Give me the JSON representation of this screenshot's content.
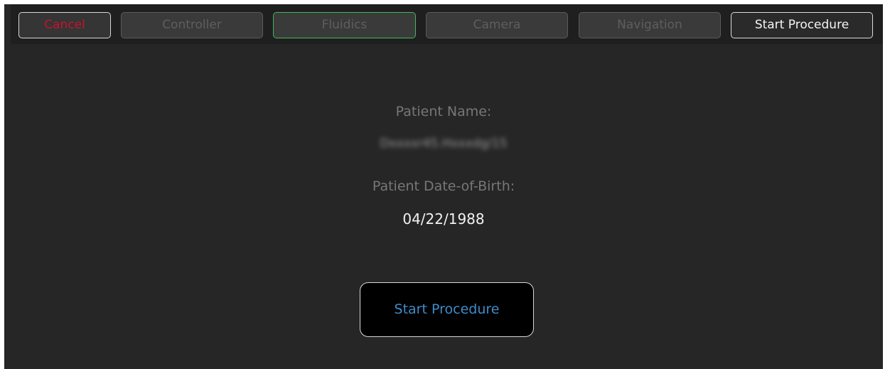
{
  "toolbar": {
    "cancel_label": "Cancel",
    "controller_label": "Controller",
    "fluidics_label": "Fluidics",
    "camera_label": "Camera",
    "navigation_label": "Navigation",
    "start_procedure_label": "Start Procedure"
  },
  "patient": {
    "name_label": "Patient Name:",
    "name_value": "Dxxxxr45.Hxxxdg/15",
    "dob_label": "Patient Date-of-Birth:",
    "dob_value": "04/22/1988"
  },
  "main": {
    "start_procedure_label": "Start Procedure"
  },
  "colors": {
    "background": "#262626",
    "cancel_text": "#c8132c",
    "fluidics_border": "#3fb860",
    "start_text": "#3d8ccc"
  }
}
